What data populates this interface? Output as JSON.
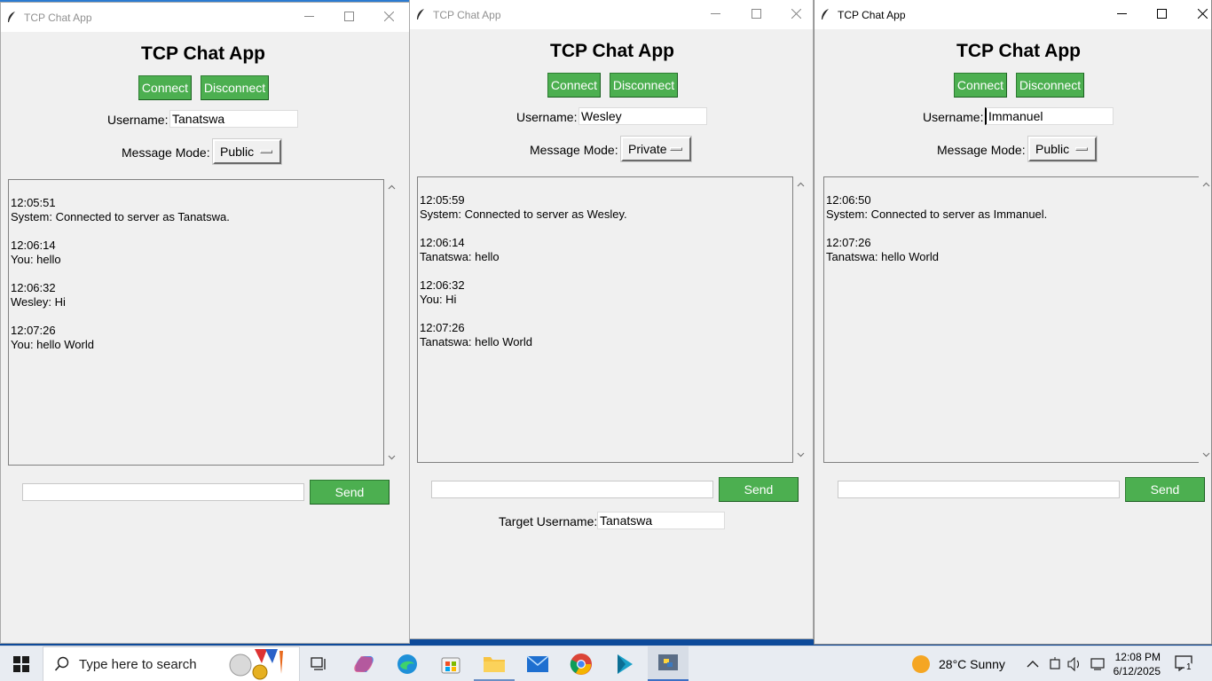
{
  "windows": [
    {
      "title": "TCP Chat App",
      "app_title": "TCP Chat App",
      "connect_label": "Connect",
      "disconnect_label": "Disconnect",
      "username_label": "Username:",
      "username_value": "Tanatswa",
      "mode_label": "Message Mode:",
      "mode_value": "Public",
      "messages": [
        {
          "time": "12:05:51",
          "text": "System: Connected to server as Tanatswa."
        },
        {
          "time": "12:06:14",
          "text": "You: hello"
        },
        {
          "time": "12:06:32",
          "text": "Wesley: Hi"
        },
        {
          "time": "12:07:26",
          "text": "You: hello World"
        }
      ],
      "message_input_value": "",
      "send_label": "Send"
    },
    {
      "title": "TCP Chat App",
      "app_title": "TCP Chat App",
      "connect_label": "Connect",
      "disconnect_label": "Disconnect",
      "username_label": "Username:",
      "username_value": "Wesley",
      "mode_label": "Message Mode:",
      "mode_value": "Private",
      "messages": [
        {
          "time": "12:05:59",
          "text": "System: Connected to server as Wesley."
        },
        {
          "time": "12:06:14",
          "text": "Tanatswa: hello"
        },
        {
          "time": "12:06:32",
          "text": "You: Hi"
        },
        {
          "time": "12:07:26",
          "text": "Tanatswa: hello World"
        }
      ],
      "message_input_value": "",
      "send_label": "Send",
      "target_label": "Target Username:",
      "target_value": "Tanatswa"
    },
    {
      "title": "TCP Chat App",
      "app_title": "TCP Chat App",
      "connect_label": "Connect",
      "disconnect_label": "Disconnect",
      "username_label": "Username:",
      "username_value": "Immanuel",
      "mode_label": "Message Mode:",
      "mode_value": "Public",
      "messages": [
        {
          "time": "12:06:50",
          "text": "System: Connected to server as Immanuel."
        },
        {
          "time": "12:07:26",
          "text": "Tanatswa: hello World"
        }
      ],
      "message_input_value": "",
      "send_label": "Send"
    }
  ],
  "taskbar": {
    "search_placeholder": "Type here to search",
    "weather": "28°C  Sunny",
    "time": "12:08 PM",
    "date": "6/12/2025",
    "notification_count": "1"
  },
  "colors": {
    "accent_green": "#4caf50",
    "window_bg": "#f0f0f0",
    "taskbar_bg": "#e8ecf2"
  }
}
